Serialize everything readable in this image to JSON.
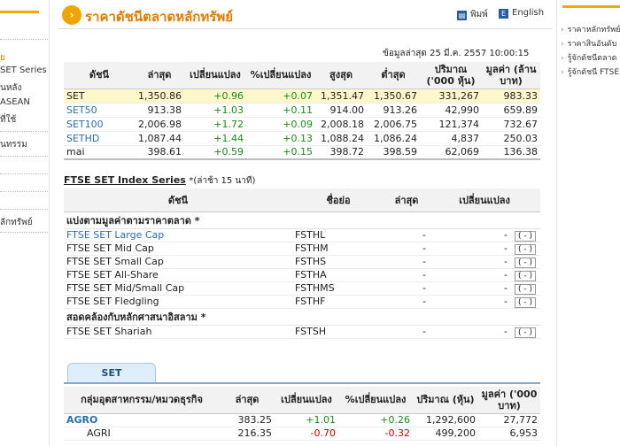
{
  "leftnav": {
    "items": [
      {
        "label": "ย",
        "orange": true
      },
      {
        "label": "SET Series",
        "orange": false
      },
      {
        "label": "นหลัง",
        "orange": false
      },
      {
        "label": "ASEAN",
        "orange": false
      },
      {
        "label": "ที่ใช้",
        "orange": false
      },
      {
        "label": "นทรรม",
        "orange": false
      },
      {
        "label": "ลักทรัพย์",
        "orange": false
      }
    ]
  },
  "rightnav": {
    "links": [
      "ราคาหลักทรัพย์",
      "ราคาสินอันดับ",
      "รู้จักดัชนีตลาด",
      "รู้จักดัชนี FTSE"
    ]
  },
  "header": {
    "title": "ราคาดัชนีตลาดหลักทรัพย์",
    "print_label": "พิมพ์",
    "english_label": "English"
  },
  "last_update": "ข้อมูลล่าสุด 25 มี.ค. 2557 10:00:15",
  "index_table": {
    "headers": [
      "ดัชนี",
      "ล่าสุด",
      "เปลี่ยนแปลง",
      "%เปลี่ยนแปลง",
      "สูงสุด",
      "ต่ำสุด",
      "ปริมาณ ('000 หุ้น)",
      "มูลค่า (ล้านบาท)"
    ],
    "rows": [
      {
        "name": "SET",
        "last": "1,350.86",
        "change": "+0.96",
        "pct": "+0.07",
        "high": "1,351.47",
        "low": "1,350.67",
        "volume": "331,267",
        "value": "983.33",
        "link": false
      },
      {
        "name": "SET50",
        "last": "913.38",
        "change": "+1.03",
        "pct": "+0.11",
        "high": "914.00",
        "low": "913.26",
        "volume": "42,990",
        "value": "659.89",
        "link": true
      },
      {
        "name": "SET100",
        "last": "2,006.98",
        "change": "+1.72",
        "pct": "+0.09",
        "high": "2,008.18",
        "low": "2,006.75",
        "volume": "121,374",
        "value": "732.67",
        "link": true
      },
      {
        "name": "SETHD",
        "last": "1,087.44",
        "change": "+1.44",
        "pct": "+0.13",
        "high": "1,088.24",
        "low": "1,086.24",
        "volume": "4,837",
        "value": "250.03",
        "link": true
      },
      {
        "name": "mai",
        "last": "398.61",
        "change": "+0.59",
        "pct": "+0.15",
        "high": "398.72",
        "low": "398.59",
        "volume": "62,069",
        "value": "136.38",
        "link": false
      }
    ]
  },
  "ftse": {
    "title": "FTSE SET Index Series",
    "note": "*(ล่าช้า 15 นาที)",
    "headers": [
      "ดัชนี",
      "ชื่อย่อ",
      "ล่าสุด",
      "เปลี่ยนแปลง"
    ],
    "category1": "แบ่งตามมูลค่าตามราคาตลาด *",
    "rows1": [
      {
        "name": "FTSE SET Large Cap",
        "symbol": "FSTHL",
        "last": "-",
        "change": "-",
        "pct": "( - )",
        "link": true
      },
      {
        "name": "FTSE SET Mid Cap",
        "symbol": "FSTHM",
        "last": "-",
        "change": "-",
        "pct": "( - )",
        "link": false
      },
      {
        "name": "FTSE SET Small Cap",
        "symbol": "FSTHS",
        "last": "-",
        "change": "-",
        "pct": "( - )",
        "link": false
      },
      {
        "name": "FTSE SET All-Share",
        "symbol": "FSTHA",
        "last": "-",
        "change": "-",
        "pct": "( - )",
        "link": false
      },
      {
        "name": "FTSE SET Mid/Small Cap",
        "symbol": "FSTHMS",
        "last": "-",
        "change": "-",
        "pct": "( - )",
        "link": false
      },
      {
        "name": "FTSE SET Fledgling",
        "symbol": "FSTHF",
        "last": "-",
        "change": "-",
        "pct": "( - )",
        "link": false
      }
    ],
    "category2": "สอดคล้องกับหลักศาสนาอิสลาม *",
    "rows2": [
      {
        "name": "FTSE SET Shariah",
        "symbol": "FSTSH",
        "last": "-",
        "change": "-",
        "pct": "( - )",
        "link": false
      }
    ]
  },
  "set_tab": {
    "label": "SET"
  },
  "sector_table": {
    "headers": [
      "กลุ่มอุตสาหกรรม/หมวดธุรกิจ",
      "ล่าสุด",
      "เปลี่ยนแปลง",
      "%เปลี่ยนแปลง",
      "ปริมาณ (หุ้น)",
      "มูลค่า ('000 บาท)"
    ],
    "rows": [
      {
        "name": "AGRO",
        "last": "383.25",
        "change": "+1.01",
        "pct": "+0.26",
        "volume": "1,292,600",
        "value": "27,772",
        "dir": "up",
        "group": true
      },
      {
        "name": "AGRI",
        "last": "216.35",
        "change": "-0.70",
        "pct": "-0.32",
        "volume": "499,200",
        "value": "6,953",
        "dir": "down",
        "group": false
      }
    ]
  }
}
